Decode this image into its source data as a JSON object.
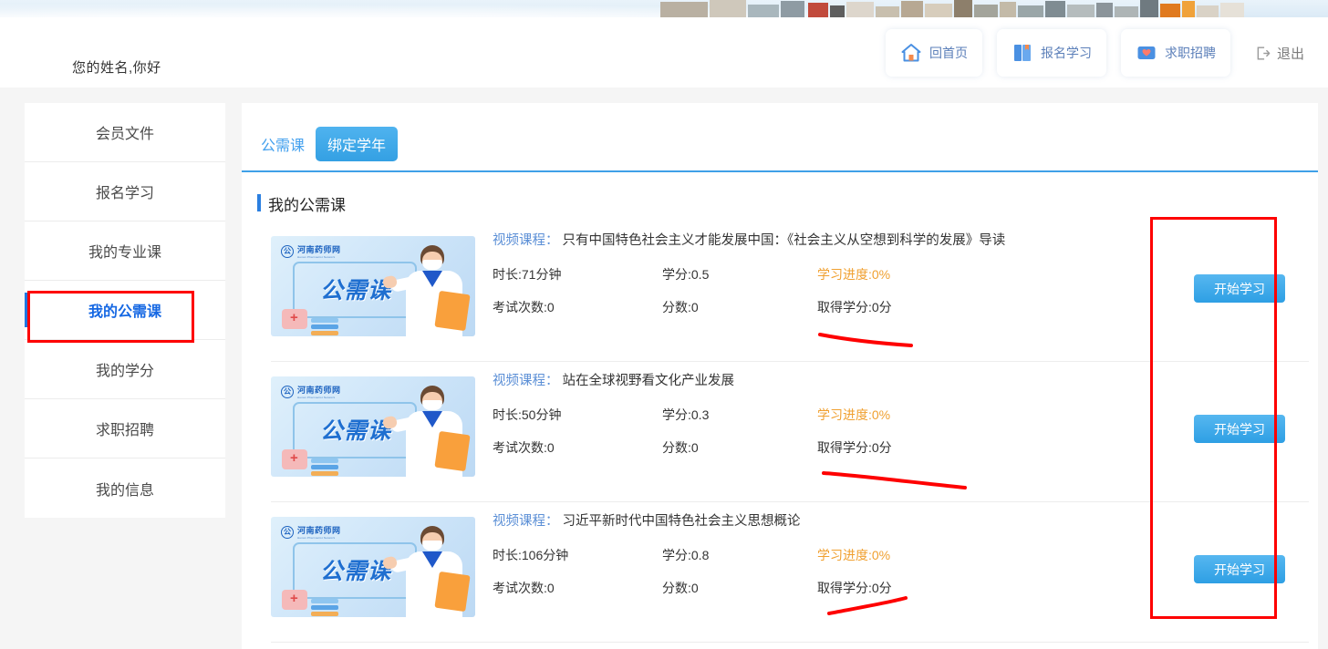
{
  "header": {
    "greeting": "您的姓名,你好",
    "nav": [
      {
        "label": "回首页",
        "icon": "home-icon"
      },
      {
        "label": "报名学习",
        "icon": "book-icon"
      },
      {
        "label": "求职招聘",
        "icon": "envelope-heart-icon"
      }
    ],
    "logout": {
      "label": "退出",
      "icon": "logout-icon"
    }
  },
  "sidebar": {
    "items": [
      {
        "label": "会员文件",
        "active": false
      },
      {
        "label": "报名学习",
        "active": false
      },
      {
        "label": "我的专业课",
        "active": false
      },
      {
        "label": "我的公需课",
        "active": true
      },
      {
        "label": "我的学分",
        "active": false
      },
      {
        "label": "求职招聘",
        "active": false
      },
      {
        "label": "我的信息",
        "active": false
      }
    ]
  },
  "main": {
    "tabs": [
      {
        "label": "公需课",
        "style": "link"
      },
      {
        "label": "绑定学年",
        "style": "pill"
      }
    ],
    "section_title": "我的公需课",
    "thumb": {
      "brand_cn": "河南药师网",
      "brand_en": "Henan Pharmacist Network",
      "brand_mark": "公",
      "headline": "公需课"
    },
    "labels": {
      "title_prefix": "视频课程：",
      "start_button": "开始学习"
    },
    "courses": [
      {
        "title": "只有中国特色社会主义才能发展中国：《社会主义从空想到科学的发展》导读",
        "duration": "时长:71分钟",
        "credit": "学分:0.5",
        "progress": "学习进度:0%",
        "exam_count": "考试次数:0",
        "score": "分数:0",
        "earned": "取得学分:0分",
        "button": "开始学习"
      },
      {
        "title": "站在全球视野看文化产业发展",
        "duration": "时长:50分钟",
        "credit": "学分:0.3",
        "progress": "学习进度:0%",
        "exam_count": "考试次数:0",
        "score": "分数:0",
        "earned": "取得学分:0分",
        "button": "开始学习"
      },
      {
        "title": "习近平新时代中国特色社会主义思想概论",
        "duration": "时长:106分钟",
        "credit": "学分:0.8",
        "progress": "学习进度:0%",
        "exam_count": "考试次数:0",
        "score": "分数:0",
        "earned": "取得学分:0分",
        "button": "开始学习"
      }
    ]
  },
  "annotations": {
    "color": "#fe0000",
    "sidebar_box": "我的公需课",
    "action_column_box": "开始学习",
    "underlines": 3
  },
  "colors": {
    "accent_blue": "#2b7fe0",
    "tab_blue": "#43a0ee",
    "progress_orange": "#f0a030",
    "annotation_red": "#fe0000",
    "page_bg": "#f5f5f5"
  }
}
